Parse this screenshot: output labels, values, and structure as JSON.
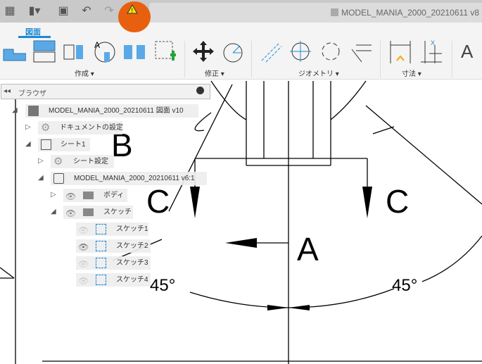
{
  "titlebar": {
    "document_title": "MODEL_MANIA_2000_20210611 v8",
    "warning_icon": "warning-icon"
  },
  "ribbon": {
    "active_tab": "図面",
    "groups": [
      "作成 ▾",
      "修正 ▾",
      "ジオメトリ ▾",
      "寸法 ▾"
    ],
    "text_tool": "A"
  },
  "browser": {
    "title": "ブラウザ",
    "root": "MODEL_MANIA_2000_20210611 図面 v10",
    "doc_settings": "ドキュメントの設定",
    "sheet": "シート1",
    "sheet_settings": "シート設定",
    "view": "MODEL_MANIA_2000_20210611 v6:1",
    "bodies": "ボディ",
    "sketches": "スケッチ",
    "sketch_items": [
      {
        "label": "スケッチ1",
        "visible": false
      },
      {
        "label": "スケッチ2",
        "visible": true
      },
      {
        "label": "スケッチ3",
        "visible": false
      },
      {
        "label": "スケッチ4",
        "visible": false
      }
    ]
  },
  "drawing": {
    "label_b": "B",
    "label_c_left": "C",
    "label_c_right": "C",
    "label_a": "A",
    "angle_left": "45°",
    "angle_right": "45°"
  }
}
